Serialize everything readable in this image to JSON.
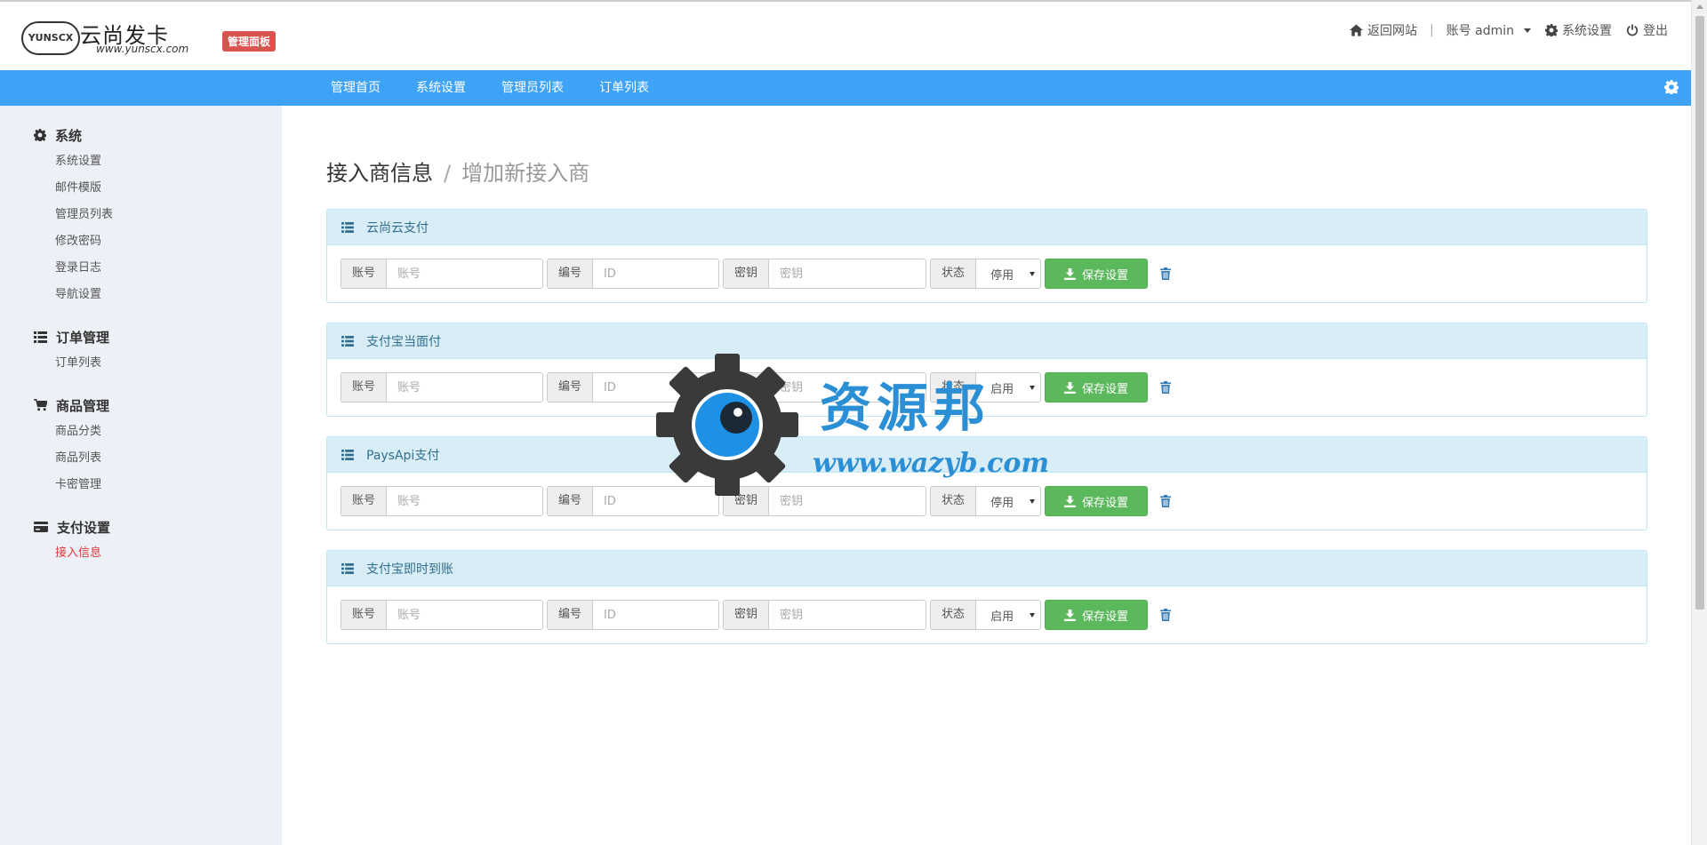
{
  "header": {
    "logo_badge": "YUNSCX",
    "logo_title": "云尚发卡",
    "logo_url": "www.yunscx.com",
    "admin_badge": "管理面板",
    "back_to_site": "返回网站",
    "separator": "|",
    "account": "账号 admin",
    "settings": "系统设置",
    "logout": "登出"
  },
  "navbar": {
    "items": [
      "管理首页",
      "系统设置",
      "管理员列表",
      "订单列表"
    ]
  },
  "sidebar": {
    "groups": [
      {
        "title": "系统",
        "icon": "gear-icon",
        "items": [
          "系统设置",
          "邮件模版",
          "管理员列表",
          "修改密码",
          "登录日志",
          "导航设置"
        ]
      },
      {
        "title": "订单管理",
        "icon": "list-icon",
        "items": [
          "订单列表"
        ]
      },
      {
        "title": "商品管理",
        "icon": "cart-icon",
        "items": [
          "商品分类",
          "商品列表",
          "卡密管理"
        ]
      },
      {
        "title": "支付设置",
        "icon": "credit-card-icon",
        "items": [
          "接入信息"
        ]
      }
    ],
    "active_item": "接入信息"
  },
  "main": {
    "title": "接入商信息",
    "title_sep": "/",
    "subtitle": "增加新接入商",
    "field_labels": {
      "account": "账号",
      "id": "编号",
      "key": "密钥",
      "status": "状态"
    },
    "placeholders": {
      "account": "账号",
      "id": "ID",
      "key": "密钥"
    },
    "save_label": "保存设置",
    "panels": [
      {
        "name": "云尚云支付",
        "status": "停用"
      },
      {
        "name": "支付宝当面付",
        "status": "启用"
      },
      {
        "name": "PaysApi支付",
        "status": "停用"
      },
      {
        "name": "支付宝即时到账",
        "status": "启用"
      }
    ]
  },
  "watermark": {
    "text": "资源邦",
    "url": "www.wazyb.com"
  },
  "colors": {
    "navbar": "#3ea3f6",
    "sidebar": "#edf0f6",
    "panel_head": "#d9edf7",
    "save_button": "#5cb85c",
    "badge": "#d9534f",
    "active_link": "#e0373a"
  }
}
